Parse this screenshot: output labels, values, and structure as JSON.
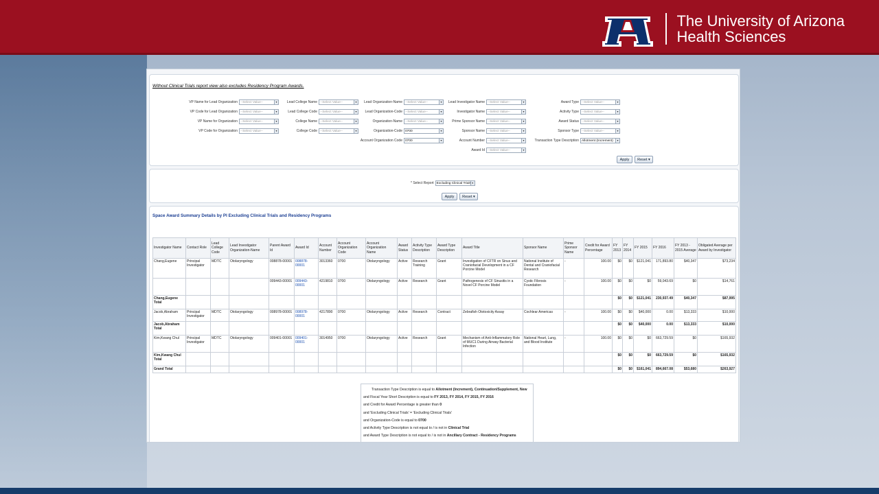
{
  "brand": {
    "line1": "The University of Arizona",
    "line2": "Health Sciences",
    "color": "#9b1020"
  },
  "note": "Without Clinical Trials report view also excludes Residency Program Awards.",
  "prompts": [
    {
      "label": "VP Name for Lead Organization",
      "value": "--Select Value--"
    },
    {
      "label": "VP Code for Lead Organization",
      "value": "--Select Value--"
    },
    {
      "label": "VP Name for Organization",
      "value": "--Select Value--"
    },
    {
      "label": "VP Code for Organization",
      "value": "--Select Value--"
    },
    {
      "label": "Lead College Name",
      "value": "--Select Value--"
    },
    {
      "label": "Lead College Code",
      "value": "--Select Value--"
    },
    {
      "label": "College Name",
      "value": "--Select Value--"
    },
    {
      "label": "College Code",
      "value": "--Select Value--"
    },
    {
      "label": "Lead Organization-Name",
      "value": "--Select Value--"
    },
    {
      "label": "Lead Organization-Code",
      "value": "--Select Value--"
    },
    {
      "label": "Organization-Name",
      "value": "--Select Value--"
    },
    {
      "label": "Organization-Code",
      "value": "0700"
    },
    {
      "label": "Account Organization Code",
      "value": "0700"
    },
    {
      "label": "Lead Investigator Name",
      "value": "--Select Value--"
    },
    {
      "label": "Investigator Name",
      "value": "--Select Value--"
    },
    {
      "label": "Prime Sponsor Name",
      "value": "--Select Value--"
    },
    {
      "label": "Sponsor Name",
      "value": "--Select Value--"
    },
    {
      "label": "Account Number",
      "value": "--Select Value--"
    },
    {
      "label": "Award Id",
      "value": "--Select Value--"
    },
    {
      "label": "Award Type",
      "value": "--Select Value--"
    },
    {
      "label": "Activity Type",
      "value": "--Select Value--"
    },
    {
      "label": "Award Status",
      "value": "--Select Value--"
    },
    {
      "label": "Sponsor Type",
      "value": "--Select Value--"
    },
    {
      "label": "Transaction Type Description",
      "value": "Allotment (Increment)"
    }
  ],
  "buttons": {
    "apply": "Apply",
    "reset": "Reset ▾"
  },
  "select_report": {
    "label": "* Select Report",
    "value": "Excluding Clinical Trials"
  },
  "report_title": "Space Award Summary Details by PI Excluding Clinical Trials and Residency Programs",
  "columns": [
    "Investigator Name",
    "Contact Role",
    "Lead College Code",
    "Lead Investigator Organization-Name",
    "Parent Award Id",
    "Award Id",
    "Account Number",
    "Account Organization Code",
    "Account Organization Name",
    "Award Status",
    "Activity Type Description",
    "Award Type Description",
    "Award Title",
    "Sponsor Name",
    "Prime Sponsor Name",
    "Credit for Award Percentage",
    "FY 2013",
    "FY 2014",
    "FY 2015",
    "FY 2016",
    "FY 2013 - 2015 Average",
    "Obligated Average per Award by Investigator"
  ],
  "rows": [
    {
      "cells": [
        "Chang,Eugene",
        "Principal Investigator",
        "MDTC",
        "Otolaryngology",
        "008878-00001",
        "008878-00001",
        "3013360",
        "0700",
        "Otolaryngology",
        "Active",
        "Research Training",
        "Grant",
        "Investigation of CFTR on Sinus and Craniofacial Development in a CF Porcine Model",
        "National Institute of Dental and Craniofacial Research",
        "-",
        "100.00",
        "$0",
        "$0",
        "$121,041",
        "171,893.80",
        "$40,347",
        "$73,234"
      ],
      "total": false
    },
    {
      "cells": [
        "",
        "",
        "",
        "",
        "009443-00001",
        "009443-00001",
        "4219810",
        "0700",
        "Otolaryngology",
        "Active",
        "Research",
        "Grant",
        "Pathogenesis of CF Sinusitis in a Novel CF Porcine Model",
        "Cystic Fibrosis Foundation",
        "-",
        "100.00",
        "$0",
        "$0",
        "$0",
        "59,043.69",
        "$0",
        "$14,761"
      ],
      "total": false
    },
    {
      "cells": [
        "Chang,Eugene Total",
        "",
        "",
        "",
        "",
        "",
        "",
        "",
        "",
        "",
        "",
        "",
        "",
        "",
        "",
        "",
        "$0",
        "$0",
        "$121,041",
        "230,937.49",
        "$40,347",
        "$87,995"
      ],
      "total": true
    },
    {
      "cells": [
        "Jacob,Abraham",
        "Principal Investigator",
        "MDTC",
        "Otolaryngology",
        "008978-00001",
        "008978-00001",
        "4217890",
        "0700",
        "Otolaryngology",
        "Active",
        "Research",
        "Contract",
        "Zebrafish Ototoxicity Assay",
        "Cochlear Americas",
        "-",
        "100.00",
        "$0",
        "$0",
        "$40,000",
        "0.00",
        "$13,333",
        "$10,000"
      ],
      "total": false
    },
    {
      "cells": [
        "Jacob,Abraham Total",
        "",
        "",
        "",
        "",
        "",
        "",
        "",
        "",
        "",
        "",
        "",
        "",
        "",
        "",
        "",
        "$0",
        "$0",
        "$40,000",
        "0.00",
        "$13,333",
        "$10,000"
      ],
      "total": true
    },
    {
      "cells": [
        "Kim,Kwang Chul",
        "Principal Investigator",
        "MDTC",
        "Otolaryngology",
        "009401-00001",
        "009401-00001",
        "3014950",
        "0700",
        "Otolaryngology",
        "Active",
        "Research",
        "Grant",
        "Mechanism of Anti-Inflammatory Role of MUC1 During Airway Bacterial Infection",
        "National Heart, Lung, and Blood Institute",
        "-",
        "100.00",
        "$0",
        "$0",
        "$0",
        "663,729.59",
        "$0",
        "$165,932"
      ],
      "total": false
    },
    {
      "cells": [
        "Kim,Kwang Chul Total",
        "",
        "",
        "",
        "",
        "",
        "",
        "",
        "",
        "",
        "",
        "",
        "",
        "",
        "",
        "",
        "$0",
        "$0",
        "$0",
        "663,729.59",
        "$0",
        "$165,932"
      ],
      "total": true
    },
    {
      "cells": [
        "Grand Total",
        "",
        "",
        "",
        "",
        "",
        "",
        "",
        "",
        "",
        "",
        "",
        "",
        "",
        "",
        "",
        "$0",
        "$0",
        "$161,041",
        "894,667.08",
        "$53,680",
        "$263,927"
      ],
      "total": true
    }
  ],
  "filters": [
    {
      "pre": "Transaction Type Description is equal to ",
      "bold": "Allotment (Increment), Continuation/Supplement, New"
    },
    {
      "pre": "and Fiscal Year Short Description is equal to ",
      "bold": "FY 2013, FY 2014, FY 2015, FY 2016"
    },
    {
      "pre": "and Credit for Award Percentage is greater than ",
      "bold": "0"
    },
    {
      "pre": "and 'Excluding Clinical Trials' = 'Excluding Clinical Trials'",
      "bold": ""
    },
    {
      "pre": "and Organization-Code is equal to ",
      "bold": "0700"
    },
    {
      "pre": "and Activity Type Description is not equal to / is not in ",
      "bold": "Clinical Trial"
    },
    {
      "pre": "and Award Type Description is not equal to / is not in ",
      "bold": "Ancillary Contract - Residency Programs"
    }
  ]
}
